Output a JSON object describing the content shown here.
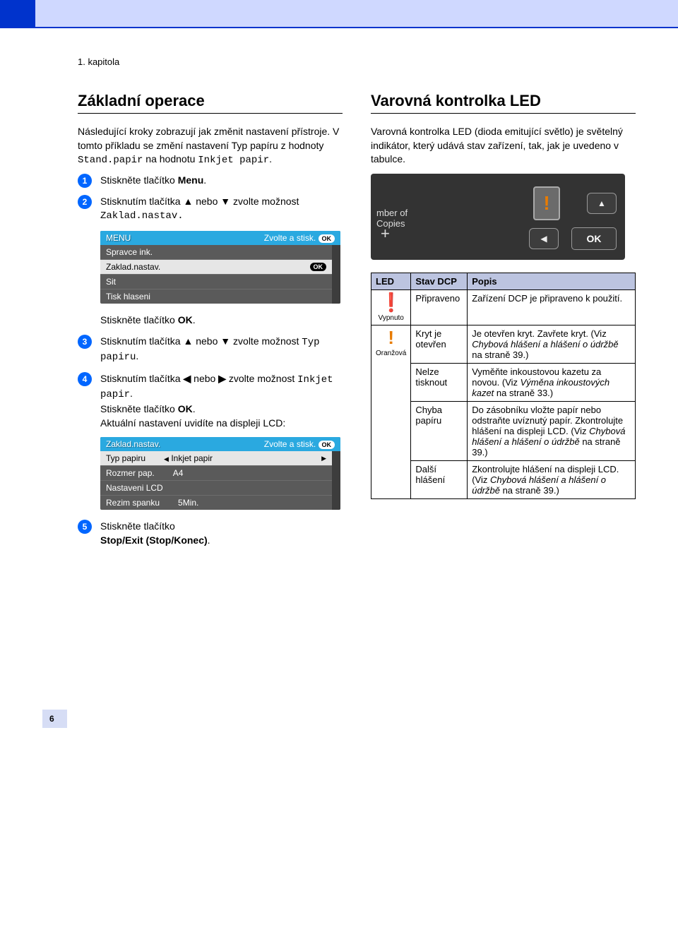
{
  "chapter": "1. kapitola",
  "left": {
    "heading": "Základní operace",
    "intro_a": "Následující kroky zobrazují jak změnit nastavení přístroje. V tomto příkladu se změní nastavení Typ papíru z hodnoty ",
    "intro_mono1": "Stand.papir",
    "intro_b": " na hodnotu ",
    "intro_mono2": "Inkjet papir",
    "intro_c": ".",
    "step1": "Stiskněte tlačítko ",
    "step1_bold": "Menu",
    "step2_a": "Stisknutím tlačítka ",
    "step2_b": " nebo ",
    "step2_c": " zvolte možnost ",
    "step2_mono": "Zaklad.nastav.",
    "lcd1": {
      "title": "MENU",
      "hint": "Zvolte a stisk.",
      "rows": [
        "Spravce ink.",
        "Zaklad.nastav.",
        "Sit",
        "Tisk hlaseni"
      ],
      "selected": 1
    },
    "step2_after": "Stiskněte tlačítko ",
    "step2_after_bold": "OK",
    "step3_a": "Stisknutím tlačítka ",
    "step3_b": " nebo ",
    "step3_c": " zvolte možnost ",
    "step3_mono": "Typ papiru",
    "step4_a": "Stisknutím tlačítka ",
    "step4_b": " nebo ",
    "step4_c": " zvolte možnost ",
    "step4_mono": "Inkjet papir",
    "step4_d": "Stiskněte tlačítko ",
    "step4_bold": "OK",
    "step4_e": "Aktuální nastavení uvidíte na displeji LCD:",
    "lcd2": {
      "title": "Zaklad.nastav.",
      "hint": "Zvolte a stisk.",
      "rows": [
        {
          "k": "Typ papiru",
          "v": "Inkjet papir",
          "sel": true
        },
        {
          "k": "Rozmer pap.",
          "v": "A4"
        },
        {
          "k": "Nastaveni LCD",
          "v": ""
        },
        {
          "k": "Rezim spanku",
          "v": "5Min."
        }
      ]
    },
    "step5_a": "Stiskněte tlačítko ",
    "step5_bold": "Stop/Exit (Stop/Konec)"
  },
  "right": {
    "heading": "Varovná kontrolka LED",
    "intro": "Varovná kontrolka LED (dioda emitující světlo) je světelný indikátor, který udává stav zařízení, tak, jak je uvedeno v tabulce.",
    "device": {
      "label1": "mber of",
      "label2": "Copies",
      "ok": "OK"
    },
    "table": {
      "headers": [
        "LED",
        "Stav DCP",
        "Popis"
      ],
      "off_label": "Vypnuto",
      "orange_label": "Oranžová",
      "rows": [
        {
          "stav": "Připraveno",
          "popis": "Zařízení DCP je připraveno k použití."
        },
        {
          "stav": "Kryt je otevřen",
          "popis_a": "Je otevřen kryt. Zavřete kryt. (Viz ",
          "popis_i": "Chybová hlášení a hlášení o údržbě",
          "popis_b": " na straně 39.)"
        },
        {
          "stav": "Nelze tisknout",
          "popis_a": "Vyměňte inkoustovou kazetu za novou. (Viz ",
          "popis_i": "Výměna inkoustových kazet",
          "popis_b": " na straně 33.)"
        },
        {
          "stav": "Chyba papíru",
          "popis_a": "Do zásobníku vložte papír nebo odstraňte uvíznutý papír. Zkontrolujte hlášení na displeji LCD. (Viz ",
          "popis_i": "Chybová hlášení a hlášení o údržbě",
          "popis_b": " na straně 39.)"
        },
        {
          "stav": "Další hlášení",
          "popis_a": "Zkontrolujte hlášení na displeji LCD. (Viz ",
          "popis_i": "Chybová hlášení a hlášení o údržbě",
          "popis_b": " na straně 39.)"
        }
      ]
    }
  },
  "page_number": "6"
}
